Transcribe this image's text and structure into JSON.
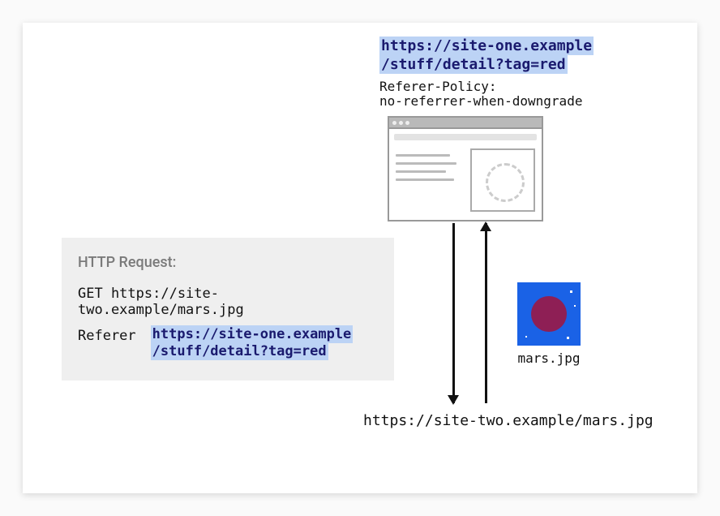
{
  "origin_url_line1": "https://site-one.example",
  "origin_url_line2": "/stuff/detail?tag=red",
  "policy_header": "Referer-Policy:",
  "policy_value": "no-referrer-when-downgrade",
  "http_request": {
    "title": "HTTP Request:",
    "method_line": "GET https://site-two.example/mars.jpg",
    "referer_label": "Referer",
    "referer_url_line1": "https://site-one.example",
    "referer_url_line2": "/stuff/detail?tag=red"
  },
  "mars_filename": "mars.jpg",
  "destination_url": "https://site-two.example/mars.jpg"
}
